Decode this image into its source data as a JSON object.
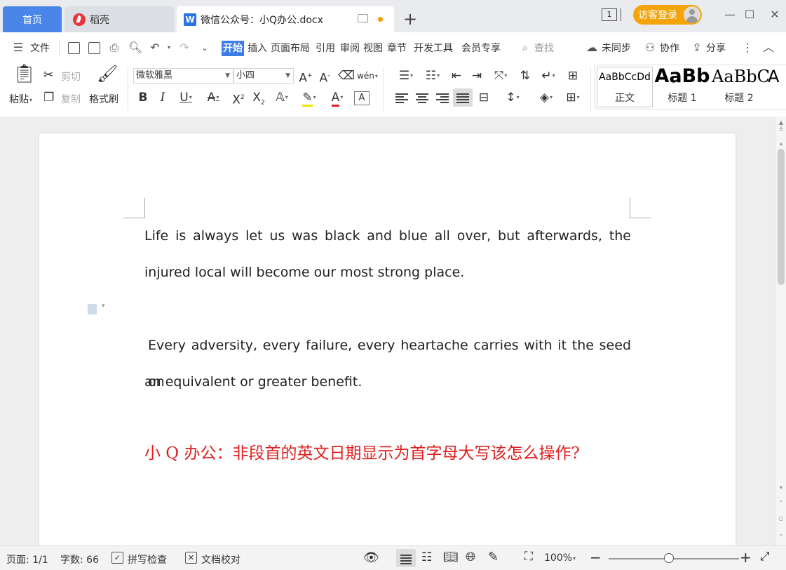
{
  "tabs": {
    "home": "首页",
    "docer": "稻壳",
    "doc": "微信公众号：小Q办公.docx",
    "doc_logo_letter": "W"
  },
  "titlebar": {
    "window_count": "1",
    "login": "访客登录"
  },
  "menubar": {
    "file": "文件",
    "items": [
      "开始",
      "插入",
      "页面布局",
      "引用",
      "审阅",
      "视图",
      "章节",
      "开发工具",
      "会员专享"
    ],
    "search": "查找",
    "sync": "未同步",
    "collab": "协作",
    "share": "分享"
  },
  "ribbon": {
    "paste": "粘贴",
    "cut": "剪切",
    "copy": "复制",
    "format_painter": "格式刷",
    "font_name": "微软雅黑",
    "font_size": "小四",
    "pinyin_glyph": "wén",
    "styles": [
      {
        "sample": "AaBbCcDd",
        "name": "正文"
      },
      {
        "sample": "AaBb",
        "name": "标题 1"
      },
      {
        "sample": "AaBbC",
        "name": "标题 2"
      },
      {
        "sample": "A",
        "name": ""
      }
    ]
  },
  "document": {
    "para1_line1": "Life is always let us was black and blue all over, but afterwards, the",
    "para1_line2": "injured local will become our most strong place.",
    "para2_line1": "Every adversity, every failure, every heartache carries with it the seed on",
    "para2_line2": "an equivalent or greater benefit.",
    "heading": "小 Q 办公：非段首的英文日期显示为首字母大写该怎么操作?"
  },
  "statusbar": {
    "page": "页面: 1/1",
    "words": "字数: 66",
    "spell": "拼写检查",
    "proof": "文档校对",
    "zoom": "100%"
  },
  "colors": {
    "accent": "#3c7ce6",
    "login": "#f4a40b",
    "heading": "#e02020"
  }
}
